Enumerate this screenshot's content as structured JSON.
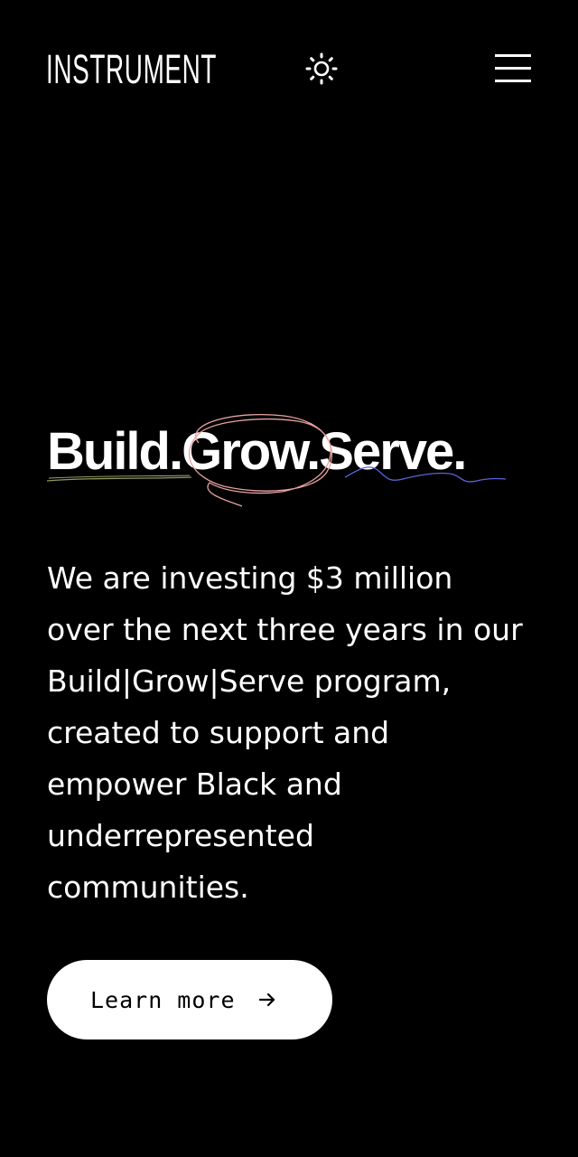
{
  "header": {
    "logo": "INSTRUMENT",
    "theme_toggle_icon": "sun-icon",
    "menu_icon": "hamburger-menu-icon"
  },
  "hero": {
    "headline": "Build.Grow.Serve.",
    "body": "We are investing $3 million over the next three years in our Build|Grow|Serve program, created to support and empower Black and underrepresented communities.",
    "cta_label": "Learn more",
    "cta_icon": "arrow-right-icon"
  },
  "colors": {
    "background": "#000000",
    "text": "#ffffff",
    "cta_background": "#ffffff",
    "cta_text": "#000000",
    "scribble_build": "#8c9a5a",
    "scribble_grow": "#e8a3a0",
    "scribble_serve": "#5a63d8"
  }
}
